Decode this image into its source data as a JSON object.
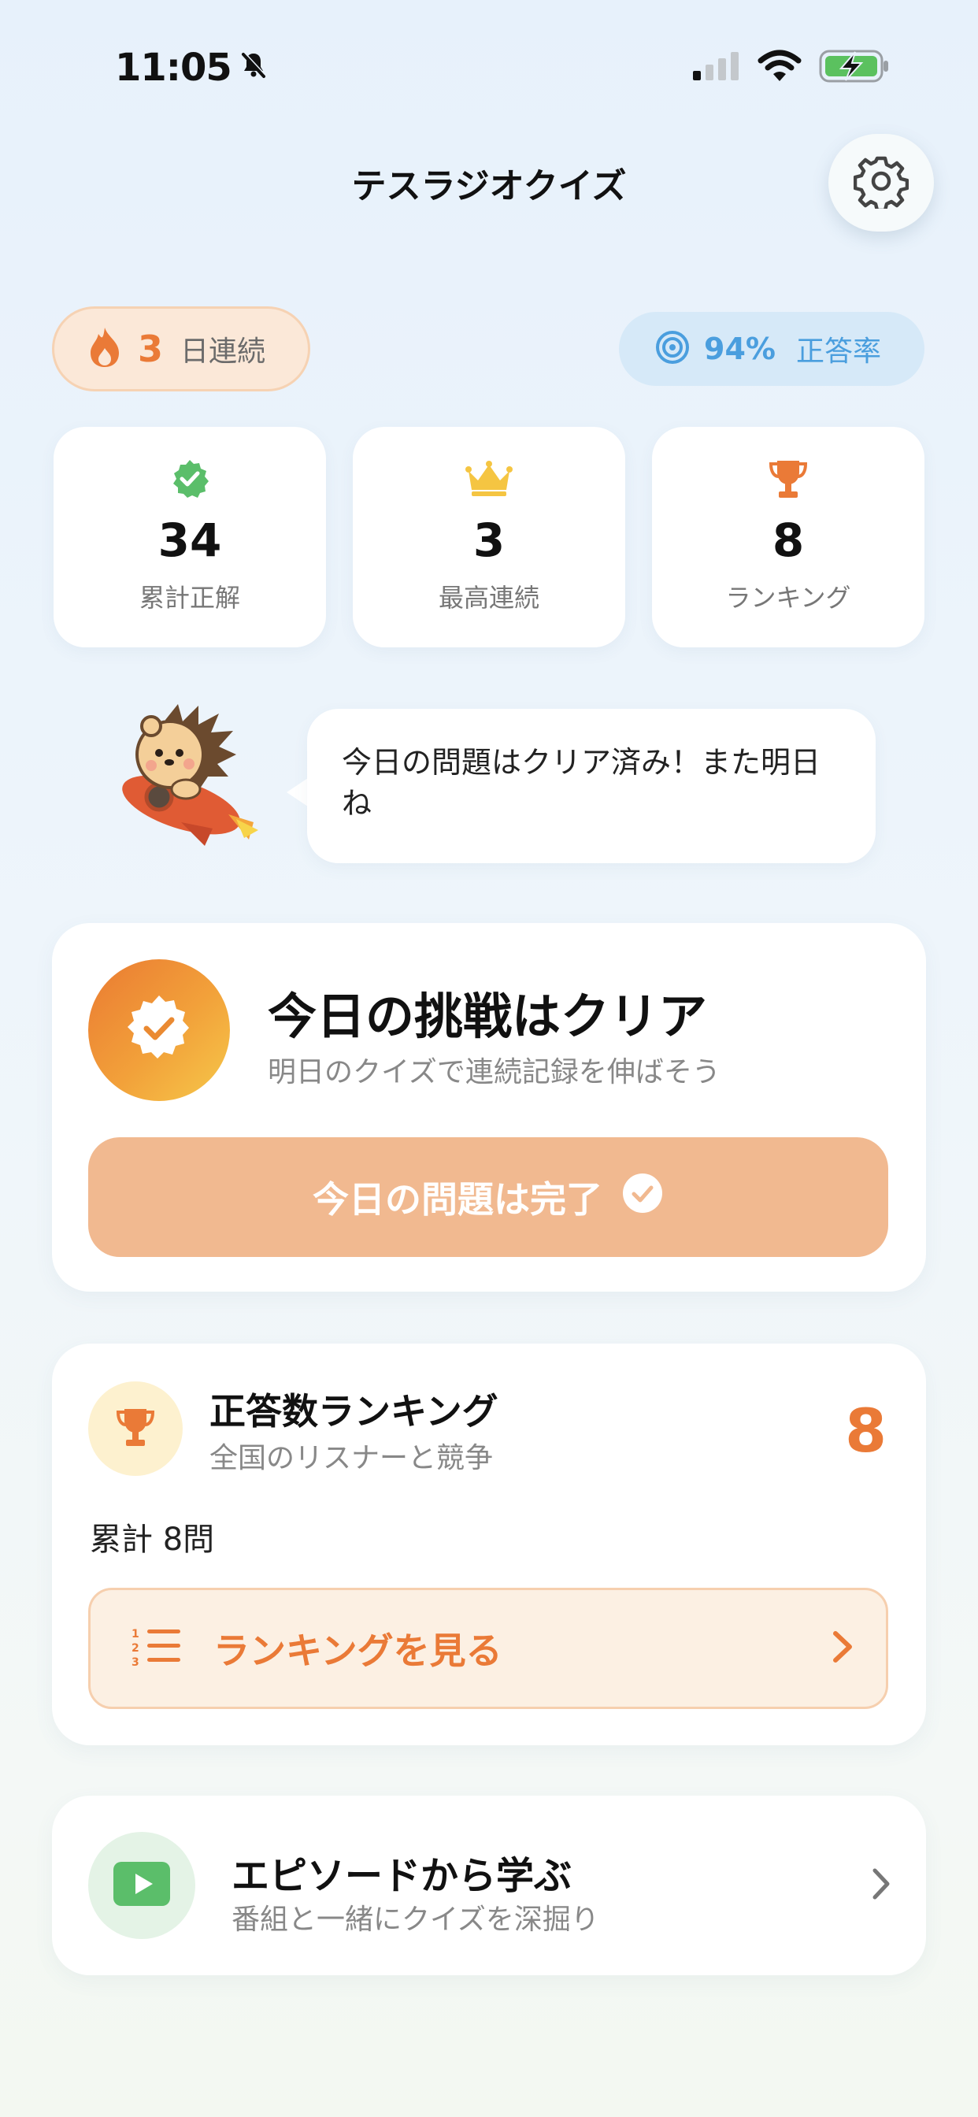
{
  "status_bar": {
    "time": "11:05",
    "icons": [
      "bell-slash-icon",
      "cellular-signal-icon",
      "wifi-icon",
      "battery-charging-icon"
    ]
  },
  "header": {
    "title": "テスラジオクイズ",
    "settings_icon": "gear-icon"
  },
  "streak": {
    "value": "3",
    "label": "日連続",
    "icon": "flame-icon",
    "color": "#EA7A37"
  },
  "accuracy": {
    "value": "94%",
    "label": "正答率",
    "icon": "target-icon",
    "color": "#4A9EDE"
  },
  "stats": [
    {
      "value": "34",
      "label": "累計正解",
      "icon": "check-badge-icon"
    },
    {
      "value": "3",
      "label": "最高連続",
      "icon": "crown-icon"
    },
    {
      "value": "8",
      "label": "ランキング",
      "icon": "trophy-icon"
    }
  ],
  "mascot": {
    "icon": "hedgehog-rocket-mascot",
    "message": "今日の問題はクリア済み！また明日ね"
  },
  "challenge": {
    "title": "今日の挑戦はクリア",
    "subtitle": "明日のクイズで連続記録を伸ばそう",
    "button_label": "今日の問題は完了",
    "badge_icon": "check-seal-icon"
  },
  "ranking": {
    "title": "正答数ランキング",
    "subtitle": "全国のリスナーと競争",
    "rank": "8",
    "total": "累計 8問",
    "button_label": "ランキングを見る",
    "icon": "trophy-icon"
  },
  "episodes": {
    "title": "エピソードから学ぶ",
    "subtitle": "番組と一緒にクイズを深掘り",
    "icon": "play-icon"
  },
  "colors": {
    "accent": "#EA7A37",
    "blue": "#4A9EDE",
    "green": "#5BBE6A",
    "button_disabled": "#F1B990"
  }
}
